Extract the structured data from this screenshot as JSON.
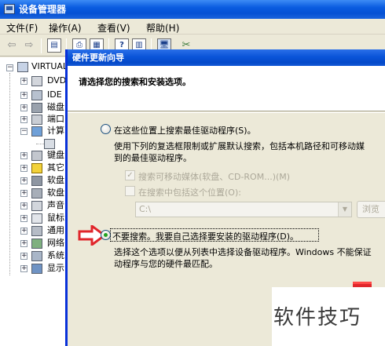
{
  "app": {
    "title": "设备管理器",
    "colors": {
      "titlebar": "#0a5ce0",
      "dialog_border": "#0831d9",
      "selected_radio": "#21a121",
      "annotation": "#e0262b"
    }
  },
  "menubar": {
    "items": [
      {
        "id": "file",
        "label": "文件(F)"
      },
      {
        "id": "action",
        "label": "操作(A)"
      },
      {
        "id": "view",
        "label": "查看(V)"
      },
      {
        "id": "help",
        "label": "帮助(H)"
      }
    ]
  },
  "toolbar": {
    "icons": [
      "back-arrow-icon",
      "forward-arrow-icon",
      "properties-panel-icon",
      "print-icon",
      "help-icon",
      "view-icon",
      "scan-hardware-icon",
      "uninstall-icon"
    ]
  },
  "tree": {
    "root": "VIRTUAL",
    "items": [
      {
        "label": "DVD",
        "icon": "dvd-drive-icon"
      },
      {
        "label": "IDE",
        "icon": "ide-controller-icon"
      },
      {
        "label": "磁盘",
        "icon": "disk-drive-icon"
      },
      {
        "label": "端口",
        "icon": "port-icon"
      },
      {
        "label": "计算",
        "icon": "computer-icon"
      },
      {
        "label": "",
        "icon": "device-icon"
      },
      {
        "label": "键盘",
        "icon": "keyboard-icon"
      },
      {
        "label": "其它",
        "icon": "unknown-device-icon"
      },
      {
        "label": "软盘",
        "icon": "floppy-controller-icon"
      },
      {
        "label": "软盘",
        "icon": "floppy-drive-icon"
      },
      {
        "label": "声音",
        "icon": "sound-icon"
      },
      {
        "label": "鼠标",
        "icon": "mouse-icon"
      },
      {
        "label": "通用",
        "icon": "usb-icon"
      },
      {
        "label": "网络",
        "icon": "network-icon"
      },
      {
        "label": "系统",
        "icon": "system-icon"
      },
      {
        "label": "显示",
        "icon": "display-icon"
      }
    ]
  },
  "wizard": {
    "title": "硬件更新向导",
    "header": "请选择您的搜索和安装选项。",
    "option_search": {
      "label": "在这些位置上搜索最佳驱动程序(S)。",
      "desc_line1": "使用下列的复选框限制或扩展默认搜索，包括本机路径和可移动媒",
      "desc_line2": "到的最佳驱动程序。",
      "checkbox_removable": "搜索可移动媒体(软盘、CD-ROM...)(M)",
      "checkbox_location": "在搜索中包括这个位置(O):",
      "path_value": "C:\\",
      "browse_label": "浏览"
    },
    "option_manual": {
      "label": "不要搜索。我要自己选择要安装的驱动程序(D)。",
      "desc_line1": "选择这个选项以便从列表中选择设备驱动程序。Windows 不能保证",
      "desc_line2": "动程序与您的硬件最匹配。"
    }
  },
  "watermark": "软件技巧"
}
